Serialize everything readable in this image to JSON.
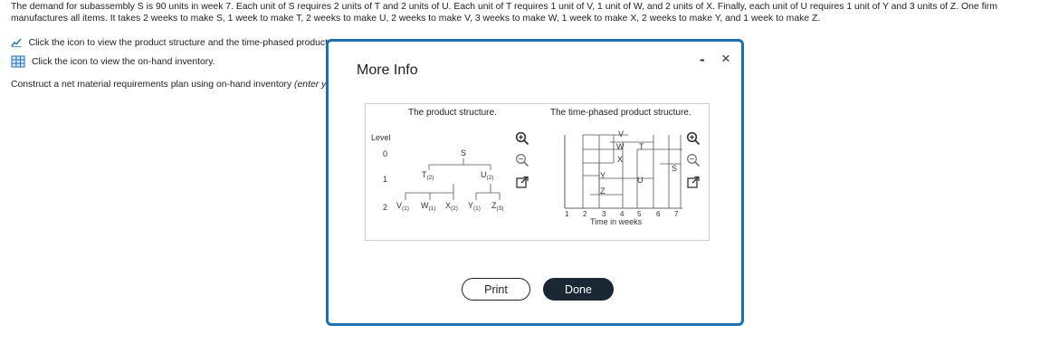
{
  "problem": {
    "text": "The demand for subassembly S is 90 units in week 7. Each unit of S requires 2 units of T and 2 units of U. Each unit of T requires 1 unit of V, 1 unit of W, and 2 units of X. Finally, each unit of U requires 1 unit of Y and 3 units of Z. One firm manufactures all items. It takes 2 weeks to make S, 1 week to make T, 2 weeks to make U, 2 weeks to make V, 3 weeks to make W, 1 week to make X, 2 weeks to make Y, and 1 week to make Z."
  },
  "links": {
    "product_structure": "Click the icon to view the product structure and the time-phased product",
    "inventory": "Click the icon to view the on-hand inventory."
  },
  "instruction": {
    "text": "Construct a net material requirements plan using on-hand inventory ",
    "italic": "(enter yo"
  },
  "modal": {
    "title": "More Info",
    "minimize": "-",
    "close": "×",
    "print": "Print",
    "done": "Done"
  },
  "figure": {
    "left_title": "The product structure.",
    "right_title": "The time-phased product structure.",
    "tree": {
      "level_label": "Level",
      "levels": [
        "0",
        "1",
        "2"
      ],
      "root": "S",
      "level1": [
        {
          "name": "T",
          "qty": "(2)"
        },
        {
          "name": "U",
          "qty": "(2)"
        }
      ],
      "level2": [
        {
          "name": "V",
          "qty": "(1)"
        },
        {
          "name": "W",
          "qty": "(1)"
        },
        {
          "name": "X",
          "qty": "(2)"
        },
        {
          "name": "Y",
          "qty": "(1)"
        },
        {
          "name": "Z",
          "qty": "(3)"
        }
      ]
    },
    "timeline": {
      "xlabel": "Time in weeks",
      "ticks": [
        "1",
        "2",
        "3",
        "4",
        "5",
        "6",
        "7"
      ],
      "items": [
        "V",
        "W",
        "X",
        "T",
        "Y",
        "Z",
        "U",
        "S"
      ]
    }
  }
}
